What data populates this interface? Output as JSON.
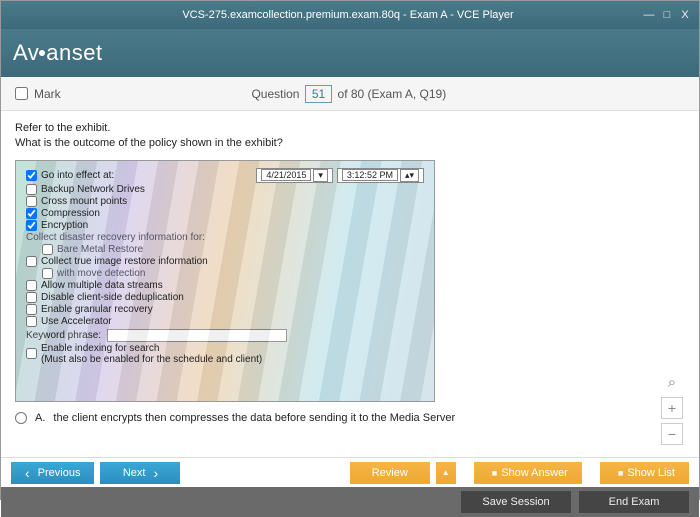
{
  "window": {
    "title": "VCS-275.examcollection.premium.exam.80q - Exam A - VCE Player",
    "min": "—",
    "max": "□",
    "close": "X"
  },
  "logo": "Avanset",
  "questionbar": {
    "mark": "Mark",
    "label_pre": "Question",
    "number": "51",
    "label_post": " of 80 (Exam A, Q19)"
  },
  "question": {
    "line1": "Refer to the exhibit.",
    "line2": "What is the outcome of the policy shown in the exhibit?"
  },
  "exhibit": {
    "go_into_effect": "Go into effect at:",
    "date": "4/21/2015",
    "time": "3:12:52 PM",
    "backup_net": "Backup Network Drives",
    "cross_mount": "Cross mount points",
    "compression": "Compression",
    "encryption": "Encryption",
    "collect_dr": "Collect disaster recovery information for:",
    "bare_metal": "Bare Metal Restore",
    "collect_true": "Collect true image restore information",
    "with_move": "with move detection",
    "allow_multiple": "Allow multiple data streams",
    "disable_dedup": "Disable client-side deduplication",
    "enable_granular": "Enable granular recovery",
    "use_accel": "Use Accelerator",
    "keyword": "Keyword phrase:",
    "enable_index": "Enable indexing for search",
    "enable_index2": "(Must also be enabled for the schedule and client)"
  },
  "answer": {
    "letter": "A.",
    "text": "the client encrypts then compresses the data before sending it to the Media Server"
  },
  "buttons": {
    "previous": "Previous",
    "next": "Next",
    "review": "Review",
    "show_answer": "Show Answer",
    "show_list": "Show List",
    "save_session": "Save Session",
    "end_exam": "End Exam"
  },
  "zoom": {
    "mag": "⌕",
    "plus": "+",
    "minus": "−"
  }
}
